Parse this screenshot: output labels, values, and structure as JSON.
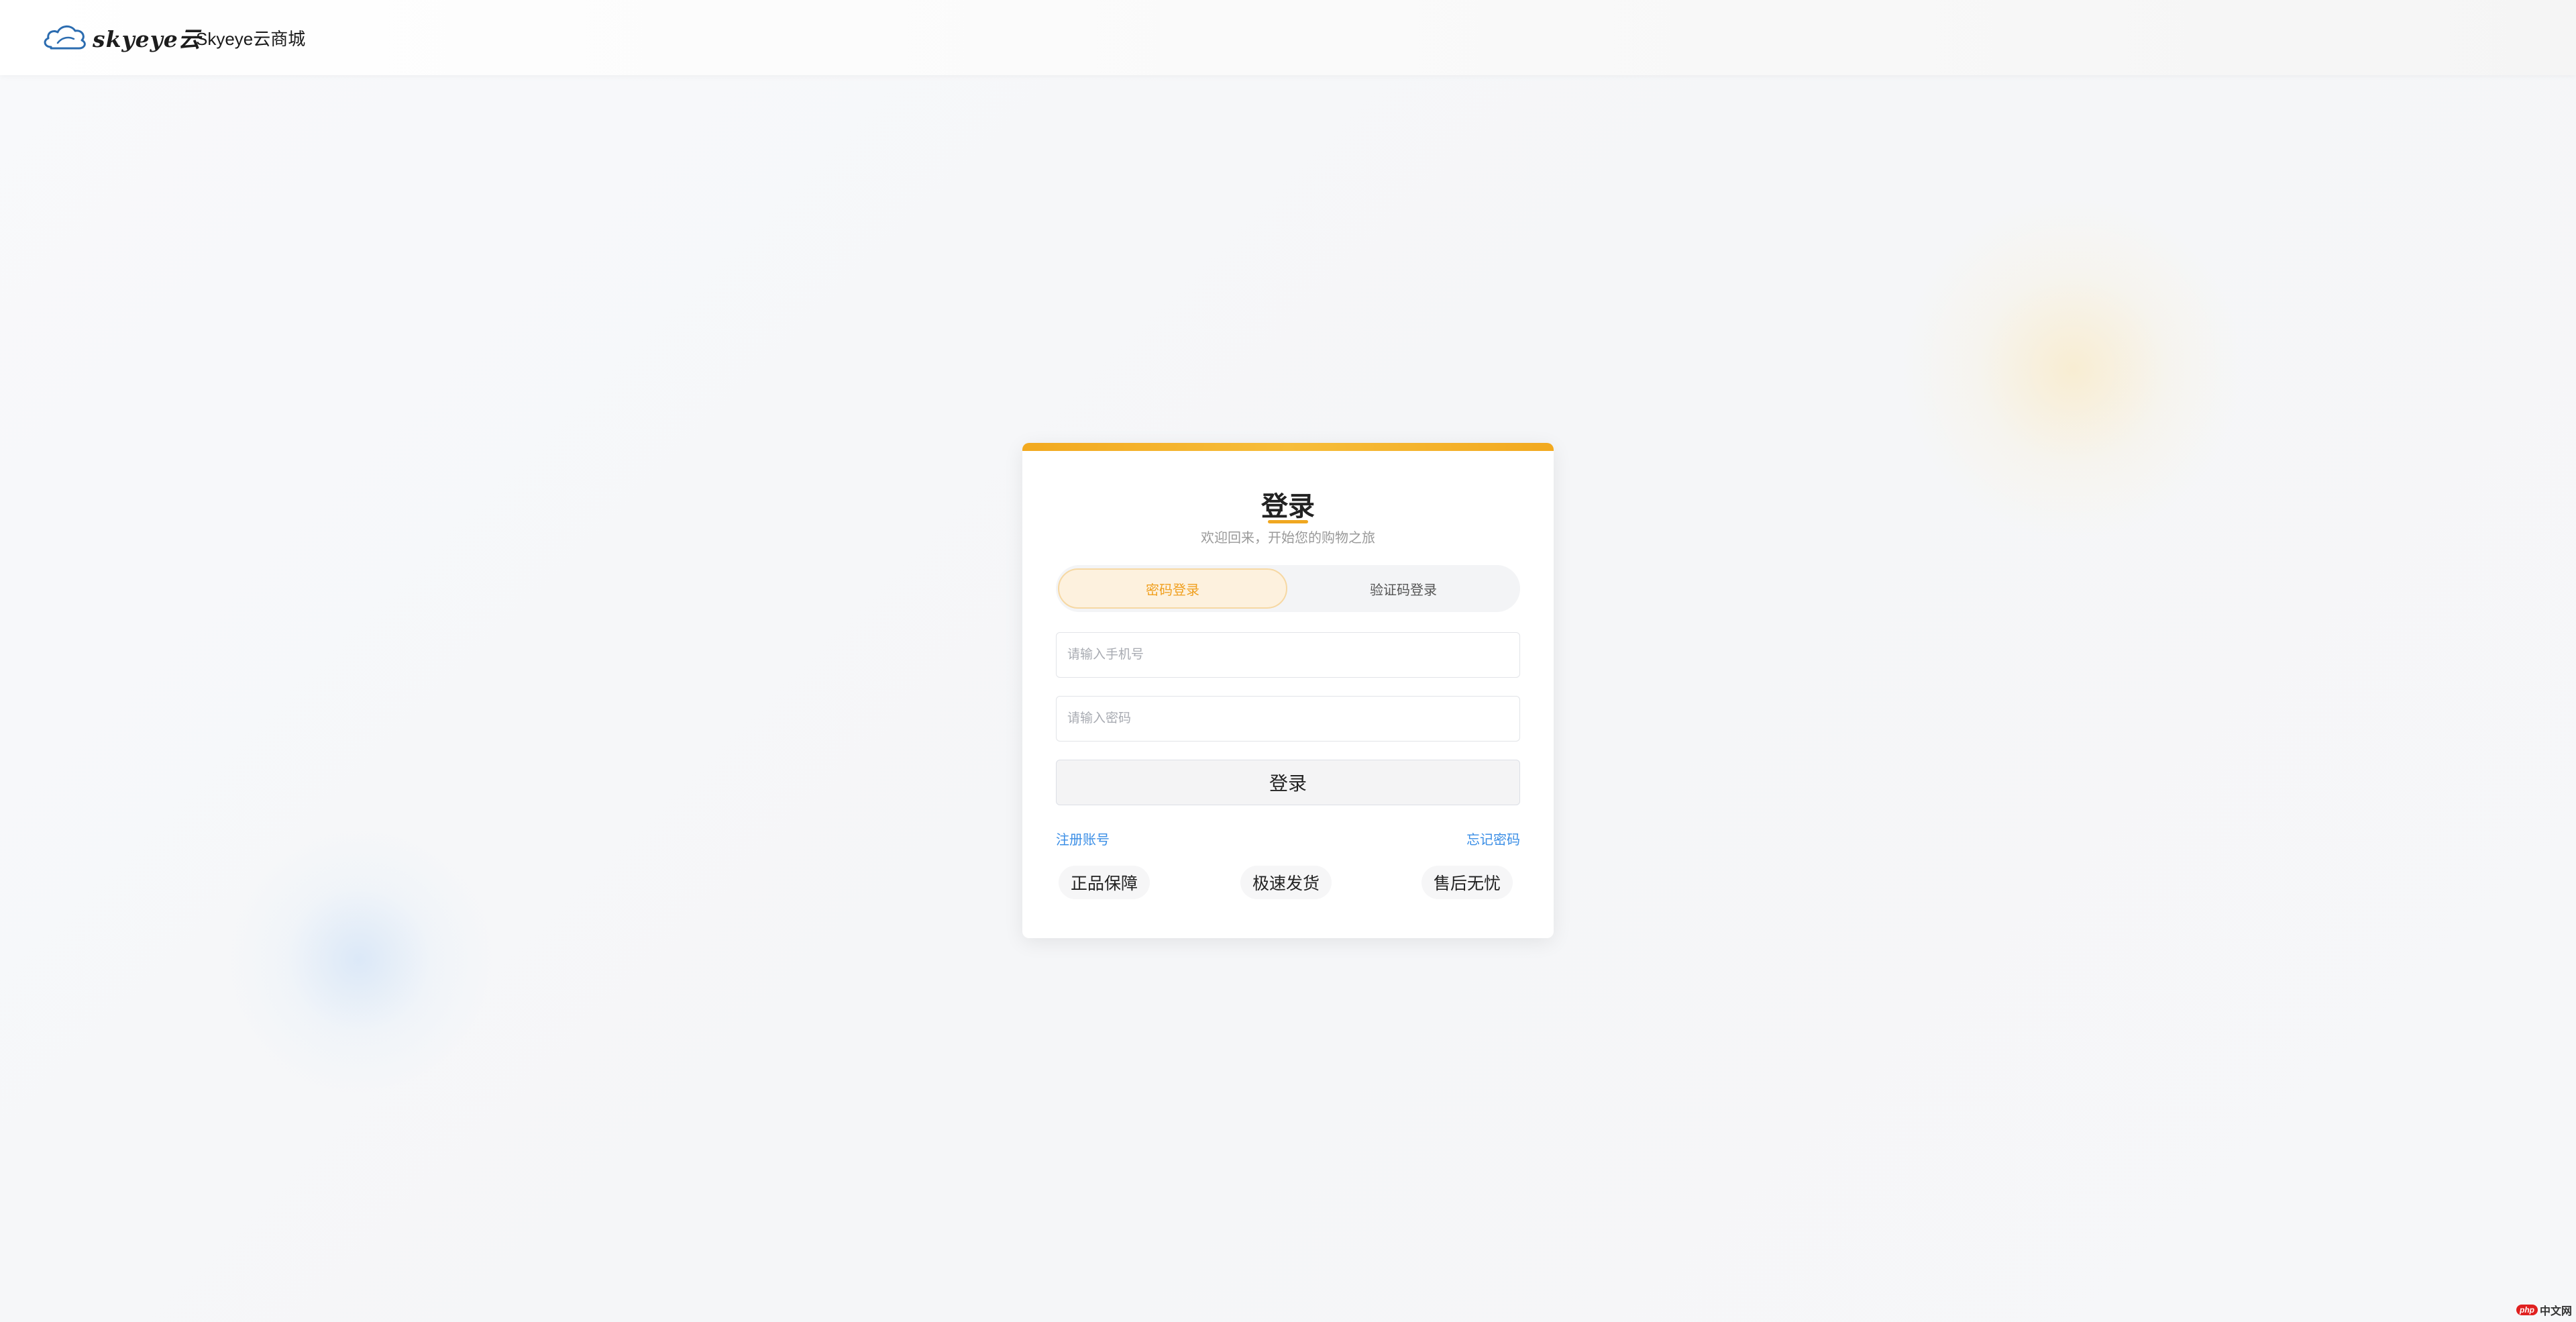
{
  "header": {
    "logo_text": "skyeye云",
    "brand_name": "Skyeye云商城"
  },
  "login": {
    "title": "登录",
    "subtitle": "欢迎回来，开始您的购物之旅",
    "tabs": [
      {
        "label": "密码登录",
        "active": true
      },
      {
        "label": "验证码登录",
        "active": false
      }
    ],
    "phone_placeholder": "请输入手机号",
    "phone_value": "",
    "password_placeholder": "请输入密码",
    "password_value": "",
    "submit_label": "登录",
    "register_link": "注册账号",
    "forgot_link": "忘记密码",
    "features": [
      "正品保障",
      "极速发货",
      "售后无忧"
    ]
  },
  "watermark": {
    "badge": "php",
    "text": "中文网"
  },
  "colors": {
    "accent": "#f2a91f",
    "link": "#3a8ee6",
    "active_tab_bg": "#fdf1de",
    "active_tab_text": "#f0a020"
  },
  "icons": {
    "logo": "cloud-logo-icon"
  }
}
